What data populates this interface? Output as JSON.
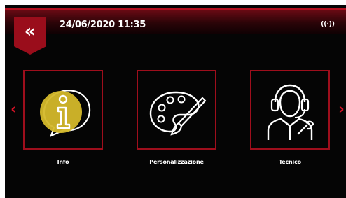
{
  "header": {
    "datetime": "24/06/2020 11:35",
    "wifi_label": "((·))"
  },
  "nav": {
    "back_glyph": "«",
    "prev_glyph": "‹",
    "next_glyph": "›"
  },
  "menu": [
    {
      "label": "Info",
      "icon": "info-icon"
    },
    {
      "label": "Personalizzazione",
      "icon": "palette-icon"
    },
    {
      "label": "Tecnico",
      "icon": "technician-icon"
    }
  ],
  "colors": {
    "accent": "#c8101f",
    "highlight": "#d4b82a",
    "background": "#050505"
  }
}
